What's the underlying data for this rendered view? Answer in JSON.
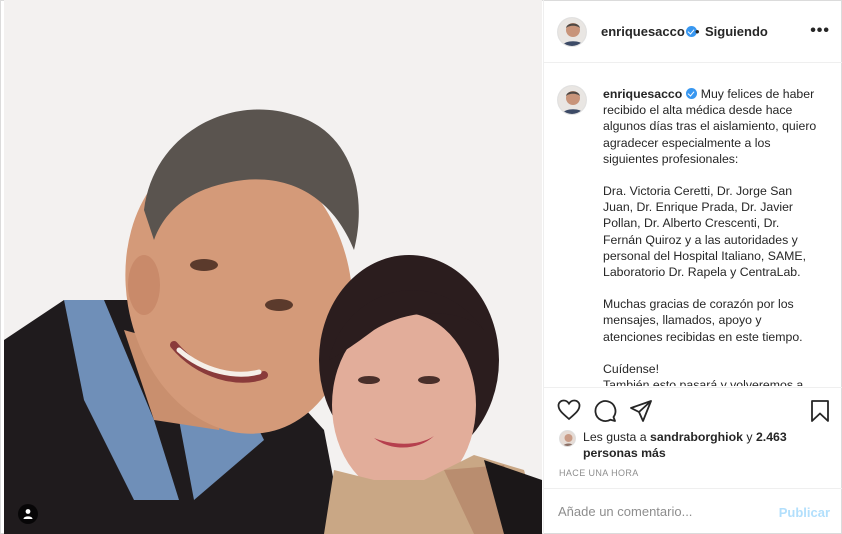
{
  "post": {
    "username": "enriquesacco",
    "verified_icon": "verified-badge-icon",
    "separator": "•",
    "follow_status": "Siguiendo",
    "more_label": "•••"
  },
  "caption": {
    "username": "enriquesacco",
    "paragraph1": "Muy felices de haber recibido el alta médica desde hace algunos días tras el aislamiento, quiero agradecer especialmente a los siguientes profesionales:",
    "paragraph2": "Dra. Victoria Ceretti, Dr. Jorge San Juan, Dr. Enrique Prada, Dr. Javier Pollan, Dr. Alberto Crescenti, Dr. Fernán Quiroz y a las autoridades y personal del Hospital Italiano, SAME, Laboratorio Dr. Rapela y CentraLab.",
    "paragraph3": "Muchas gracias de corazón por los mensajes, llamados, apoyo y atenciones recibidas en este tiempo.",
    "paragraph4a": "Cuídense!",
    "paragraph4b": "También esto pasará y volveremos a"
  },
  "likes": {
    "prefix": "Les gusta a",
    "liker": "sandraborghiok",
    "conjunction": "y",
    "others": "2.463 personas más"
  },
  "timestamp": "HACE UNA HORA",
  "comment": {
    "placeholder": "Añade un comentario...",
    "publish_label": "Publicar"
  },
  "colors": {
    "accent_blue": "#3897f0",
    "publish_disabled": "#b2dffc",
    "meta_gray": "#8e8e8e"
  }
}
